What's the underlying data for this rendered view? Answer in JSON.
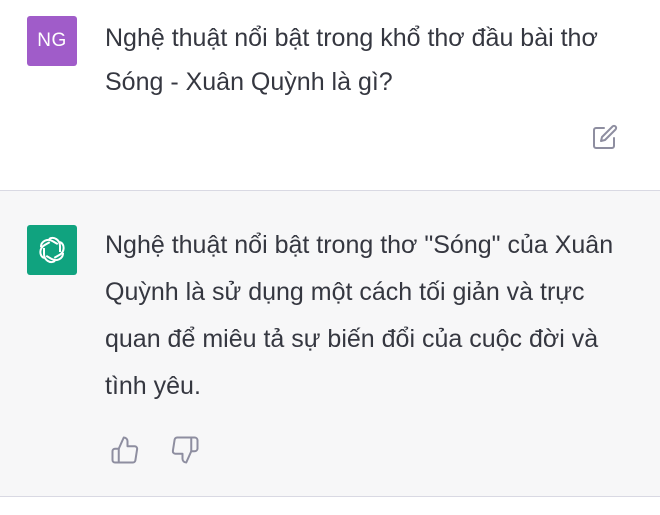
{
  "user_message": {
    "avatar_initials": "NG",
    "avatar_color": "#a05cc9",
    "text": "Nghệ thuật nổi bật trong khổ thơ đầu bài thơ Sóng - Xuân Quỳnh là gì?",
    "edit_icon": "edit-icon"
  },
  "assistant_message": {
    "avatar_icon": "openai-logo-icon",
    "avatar_color": "#10a37f",
    "text": "Nghệ thuật nổi bật trong thơ \"Sóng\" của Xuân Quỳnh là sử dụng một cách tối giản và trực quan để miêu tả sự biến đổi của cuộc đời và tình yêu.",
    "feedback": {
      "thumbs_up_icon": "thumbs-up-icon",
      "thumbs_down_icon": "thumbs-down-icon"
    }
  },
  "colors": {
    "assistant_background": "#f7f7f8",
    "text": "#353740",
    "icon_gray": "#8e8ea0"
  }
}
